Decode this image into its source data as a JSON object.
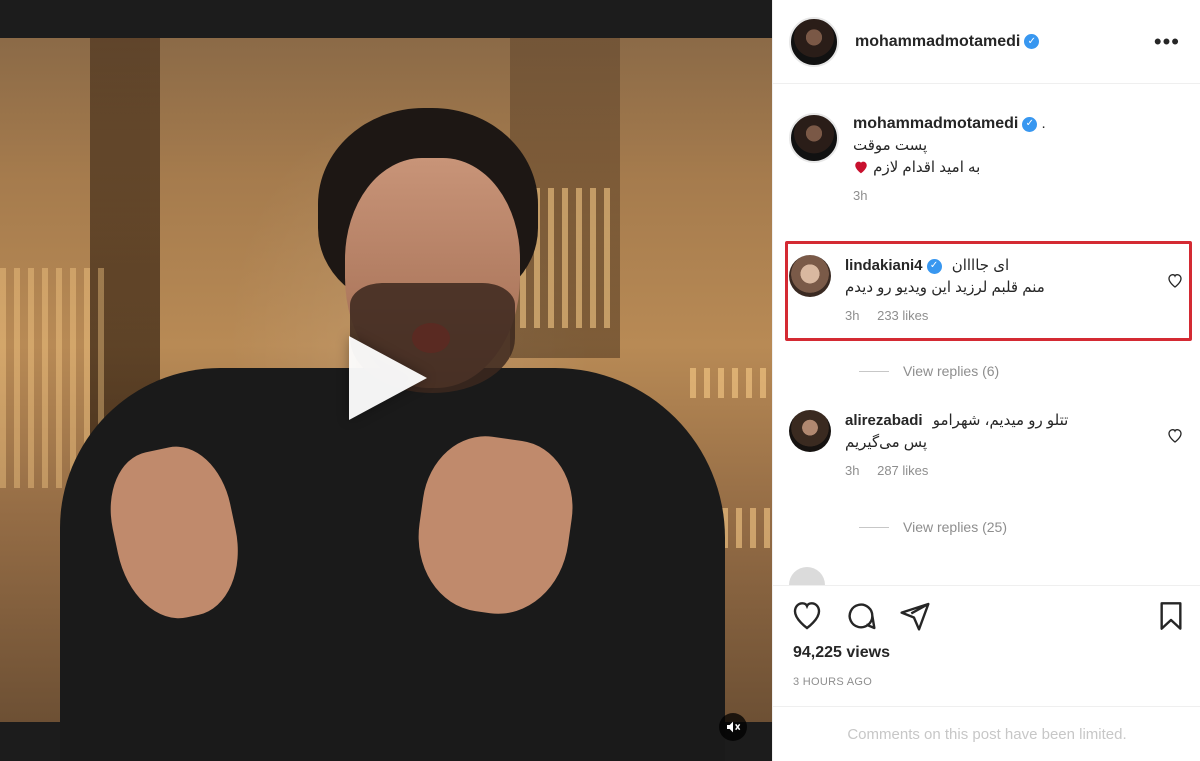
{
  "post": {
    "username": "mohammadmotamedi",
    "verified": true
  },
  "caption": {
    "username": "mohammadmotamedi",
    "line1": "پست موقت",
    "line2": "به امید اقدام لازم",
    "time": "3h"
  },
  "comments": [
    {
      "username": "lindakiani4",
      "line1": "ای جاااان",
      "line2": "منم قلبم لرزید این ویدیو رو دیدم",
      "time": "3h",
      "likes": "233 likes",
      "view_replies": "View replies (6)",
      "highlighted": true
    },
    {
      "username": "alirezabadi",
      "line1": "تتلو رو میدیم، شهرامو",
      "line2": "پس می‌گیریم",
      "time": "3h",
      "likes": "287 likes",
      "view_replies": "View replies (25)",
      "highlighted": false
    }
  ],
  "stats": {
    "views": "94,225 views",
    "ago": "3 HOURS AGO"
  },
  "footer": {
    "limited_text": "Comments on this post have been limited."
  },
  "colors": {
    "verified": "#3897f0",
    "highlight_border": "#d42a33",
    "heart": "#c8102e"
  },
  "icons": [
    "play-icon",
    "mute-icon",
    "more-icon",
    "heart-icon",
    "comment-icon",
    "share-icon",
    "bookmark-icon"
  ]
}
